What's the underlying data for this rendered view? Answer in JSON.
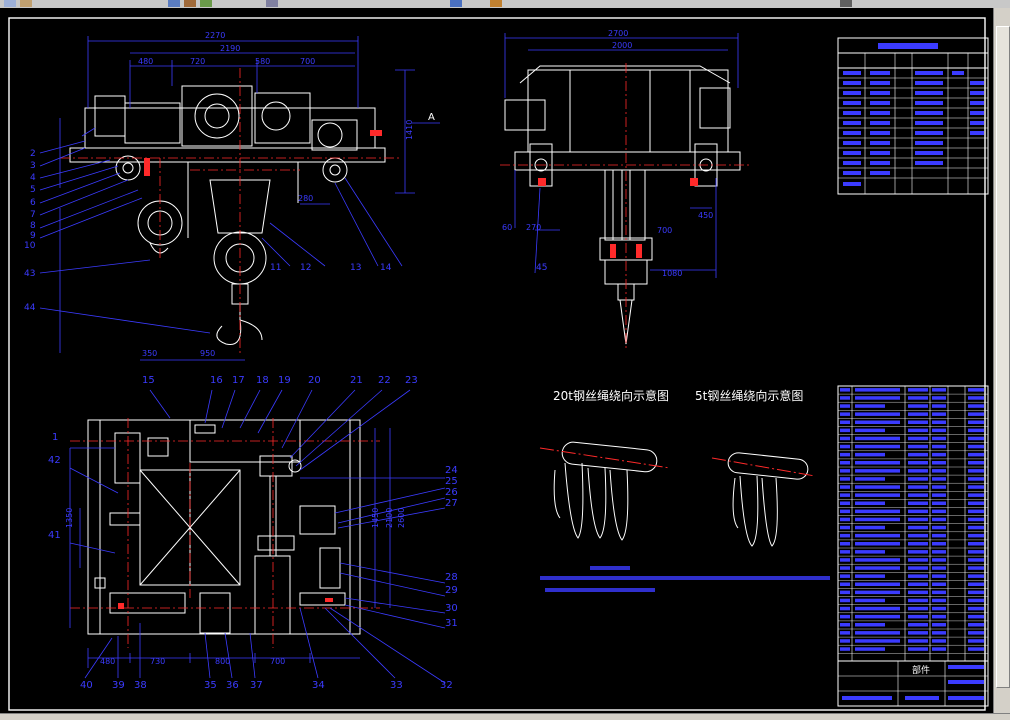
{
  "diagram_captions": {
    "caption_20t": "20t钢丝绳绕向示意图",
    "caption_5t": "5t钢丝绳绕向示意图"
  },
  "drawing_labels": {
    "section_arrow": "A",
    "stamp_cn": "部件"
  },
  "dimensions": {
    "front": [
      "2270",
      "2190",
      "480",
      "720",
      "580",
      "700",
      "280",
      "1410"
    ],
    "side": [
      "2700",
      "2000",
      "60",
      "270",
      "700",
      "1080",
      "450"
    ],
    "bottom_left": [
      "350",
      "950"
    ],
    "plan": [
      "480",
      "730",
      "800",
      "700",
      "1450",
      "2100",
      "2600",
      "1350"
    ]
  },
  "part_numbers": {
    "front_left": [
      "2",
      "3",
      "4",
      "5",
      "6",
      "7",
      "8",
      "9",
      "10"
    ],
    "front_bottom": [
      "43",
      "44",
      "11",
      "12",
      "13",
      "14"
    ],
    "side": [
      "45"
    ],
    "plan_top": [
      "15",
      "16",
      "17",
      "18",
      "19",
      "20",
      "21",
      "22",
      "23"
    ],
    "plan_left": [
      "1",
      "42",
      "41"
    ],
    "plan_right": [
      "24",
      "25",
      "26",
      "27",
      "28",
      "29",
      "30",
      "31",
      "32"
    ],
    "plan_bottom": [
      "40",
      "39",
      "38",
      "35",
      "36",
      "37",
      "34",
      "33"
    ]
  },
  "colors": {
    "background": "#000000",
    "outline": "#ffffff",
    "dimension": "#3b3bff",
    "centerline": "#ff2a2a",
    "hatch": "#ff2a2a",
    "notes": "#3b3bff",
    "chrome": "#d4d0c8"
  },
  "toolbar": {
    "icons": [
      "pointer-icon",
      "zoom-icon",
      "pan-icon",
      "undo-icon",
      "redo-icon",
      "print-icon",
      "layer-icon",
      "properties-icon",
      "help-icon"
    ]
  }
}
